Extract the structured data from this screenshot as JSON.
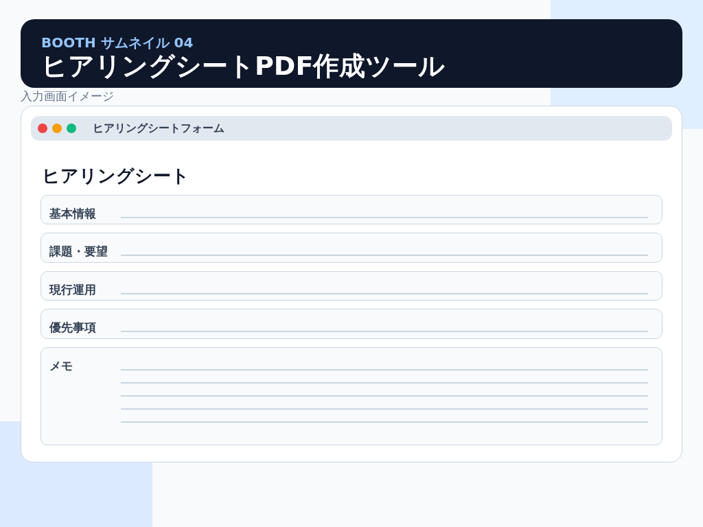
{
  "header": {
    "eyebrow": "BOOTH サムネイル 04",
    "title": "ヒアリングシートPDF作成ツール"
  },
  "subtitle": "入力画面イメージ",
  "window": {
    "title": "ヒアリングシートフォーム"
  },
  "form": {
    "heading": "ヒアリングシート",
    "fields": [
      {
        "label": "基本情報",
        "kind": "single"
      },
      {
        "label": "課題・要望",
        "kind": "single"
      },
      {
        "label": "現行運用",
        "kind": "single"
      },
      {
        "label": "優先事項",
        "kind": "single"
      },
      {
        "label": "メモ",
        "kind": "multi"
      }
    ]
  }
}
